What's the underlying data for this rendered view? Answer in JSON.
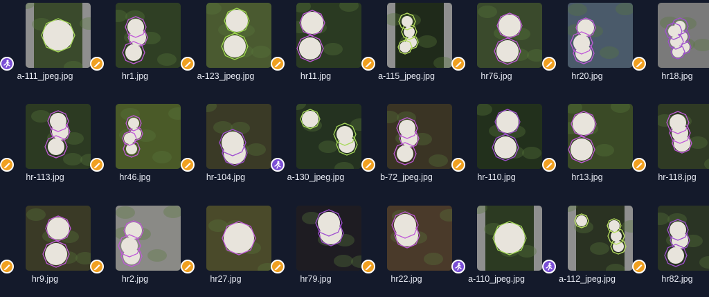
{
  "gallery": {
    "items": [
      {
        "name": "a-111_jpeg.jpg",
        "badge": "figure-icon",
        "bg": "#3a4a2c",
        "frame": "#8f8f8f",
        "poly": "#a6d85a",
        "cotton": 1
      },
      {
        "name": "hr1.jpg",
        "badge": "brush-icon",
        "bg": "#2f3f24",
        "frame": "",
        "poly": "#c05ad8",
        "cotton": 3
      },
      {
        "name": "a-123_jpeg.jpg",
        "badge": "brush-icon",
        "bg": "#4a5a30",
        "frame": "",
        "poly": "#9fd850",
        "cotton": 2
      },
      {
        "name": "hr11.jpg",
        "badge": "brush-icon",
        "bg": "#2a3a22",
        "frame": "",
        "poly": "#c05ad8",
        "cotton": 2
      },
      {
        "name": "a-115_jpeg.jpg",
        "badge": "brush-icon",
        "bg": "#1f2a1a",
        "frame": "#8f8f8f",
        "poly": "#b8e060",
        "cotton": 4
      },
      {
        "name": "hr76.jpg",
        "badge": "brush-icon",
        "bg": "#3a4a2c",
        "frame": "",
        "poly": "#c05ad8",
        "cotton": 2
      },
      {
        "name": "hr20.jpg",
        "badge": "brush-icon",
        "bg": "#4a5a6a",
        "frame": "",
        "poly": "#c05ad8",
        "cotton": 3
      },
      {
        "name": "hr18.jpg",
        "badge": "brush-icon",
        "bg": "#7a7a7a",
        "frame": "",
        "poly": "#a050d0",
        "cotton": 6
      },
      {
        "name": "hr-113.jpg",
        "badge": "brush-icon",
        "bg": "#2c3a22",
        "frame": "",
        "poly": "#c05ad8",
        "cotton": 3
      },
      {
        "name": "hr46.jpg",
        "badge": "brush-icon",
        "bg": "#4a5a28",
        "frame": "",
        "poly": "#c05ad8",
        "cotton": 4
      },
      {
        "name": "hr-104.jpg",
        "badge": "brush-icon",
        "bg": "#3a3a26",
        "frame": "",
        "poly": "#a050d0",
        "cotton": 2
      },
      {
        "name": "a-130_jpeg.jpg",
        "badge": "figure-icon",
        "bg": "#243220",
        "frame": "",
        "poly": "#a6d85a",
        "cotton": 3
      },
      {
        "name": "b-72_jpeg.jpg",
        "badge": "brush-icon",
        "bg": "#3a3424",
        "frame": "",
        "poly": "#c05ad8",
        "cotton": 3
      },
      {
        "name": "hr-110.jpg",
        "badge": "brush-icon",
        "bg": "#22301c",
        "frame": "",
        "poly": "#a050d0",
        "cotton": 2
      },
      {
        "name": "hr13.jpg",
        "badge": "brush-icon",
        "bg": "#3a4a26",
        "frame": "",
        "poly": "#c05ad8",
        "cotton": 2
      },
      {
        "name": "hr-118.jpg",
        "badge": "brush-icon",
        "bg": "#2f3a24",
        "frame": "",
        "poly": "#c05ad8",
        "cotton": 3
      },
      {
        "name": "hr9.jpg",
        "badge": "brush-icon",
        "bg": "#3a3a26",
        "frame": "",
        "poly": "#c05ad8",
        "cotton": 2
      },
      {
        "name": "hr2.jpg",
        "badge": "brush-icon",
        "bg": "#8a8a86",
        "frame": "",
        "poly": "#c05ad8",
        "cotton": 3
      },
      {
        "name": "hr27.jpg",
        "badge": "brush-icon",
        "bg": "#4a4a2a",
        "frame": "",
        "poly": "#c05ad8",
        "cotton": 1
      },
      {
        "name": "hr79.jpg",
        "badge": "brush-icon",
        "bg": "#1e1c22",
        "frame": "",
        "poly": "#a050d0",
        "cotton": 2
      },
      {
        "name": "hr22.jpg",
        "badge": "brush-icon",
        "bg": "#4a3a2a",
        "frame": "",
        "poly": "#c05ad8",
        "cotton": 2
      },
      {
        "name": "a-110_jpeg.jpg",
        "badge": "figure-icon",
        "bg": "#2c3a22",
        "frame": "#8f8f8f",
        "poly": "#a6d85a",
        "cotton": 1
      },
      {
        "name": "a-112_jpeg.jpg",
        "badge": "figure-icon",
        "bg": "#2a3222",
        "frame": "#8f8f8f",
        "poly": "#b8e060",
        "cotton": 4
      },
      {
        "name": "hr82.jpg",
        "badge": "brush-icon",
        "bg": "#2a3424",
        "frame": "",
        "poly": "#a050d0",
        "cotton": 3
      }
    ]
  },
  "colors": {
    "brush_badge": "#f0a020",
    "figure_badge": "#7b4fd6"
  }
}
